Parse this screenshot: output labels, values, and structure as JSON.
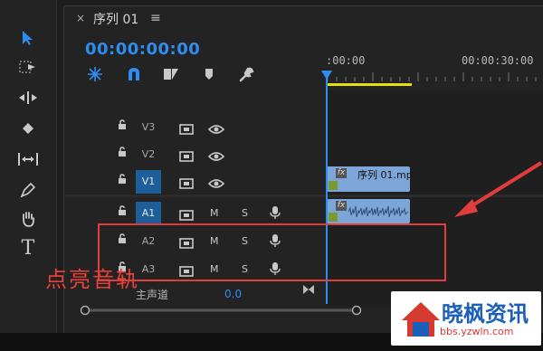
{
  "sequence_tab": {
    "title": "序列 01",
    "close_glyph": "×",
    "menu_glyph": "≡"
  },
  "timecode": "00:00:00:00",
  "ruler": {
    "labels": [
      ":00:00",
      "00:00:30:00"
    ]
  },
  "tracks": {
    "video": [
      {
        "label": "V3",
        "targeted": false
      },
      {
        "label": "V2",
        "targeted": false
      },
      {
        "label": "V1",
        "targeted": true
      }
    ],
    "audio": [
      {
        "label": "A1",
        "targeted": true,
        "m": "M",
        "s": "S"
      },
      {
        "label": "A2",
        "targeted": false,
        "m": "M",
        "s": "S"
      },
      {
        "label": "A3",
        "targeted": false,
        "m": "M",
        "s": "S"
      }
    ]
  },
  "clips": {
    "video_clip": {
      "name": "序列 01.mp",
      "fx": "fx"
    },
    "audio_clip": {
      "fx": "fx"
    }
  },
  "master": {
    "label": "主声道",
    "value": "0.0"
  },
  "annotation": {
    "text": "点亮音轨",
    "color": "#e8403a"
  },
  "watermark": {
    "name": "晓枫资讯",
    "url": "bbs.yzwln.com"
  },
  "colors": {
    "accent": "#2e8df0",
    "track_target": "#1f5f99",
    "clip": "#7da6d8",
    "workarea": "#e8e000"
  }
}
